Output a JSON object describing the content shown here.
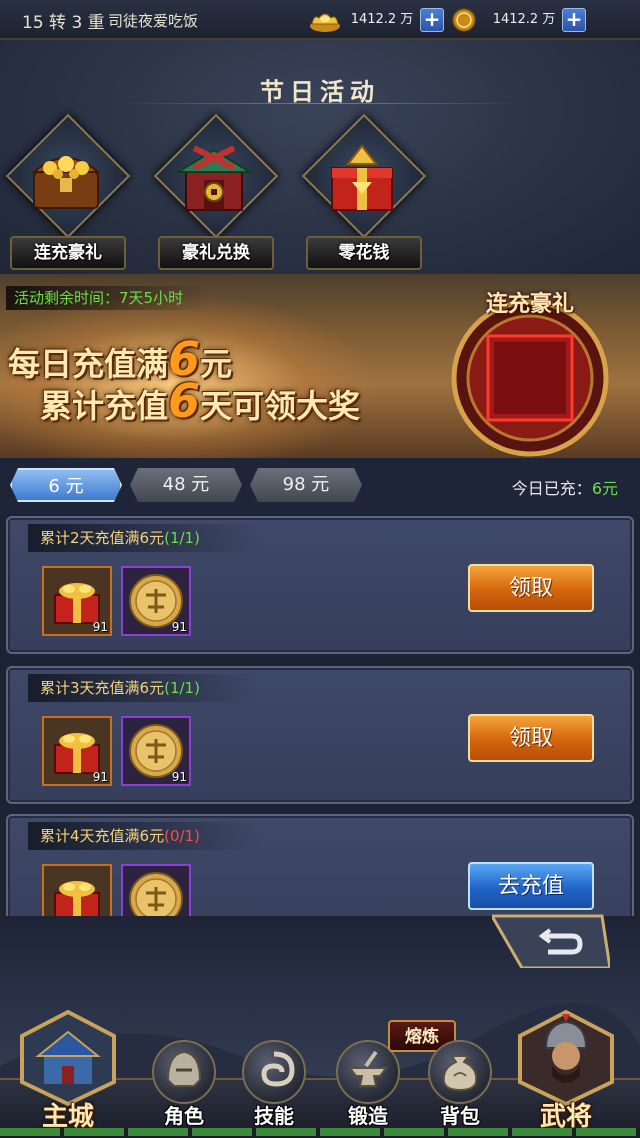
{
  "topbar": {
    "rebirth": "15 转 3 重",
    "player_name": "司徒夜爱吃饭",
    "gold_ingot": "1412.2 万",
    "coin": "1412.2 万"
  },
  "festival": {
    "title": "节日活动",
    "activities": [
      {
        "label": "连充豪礼"
      },
      {
        "label": "豪礼兑换"
      },
      {
        "label": "零花钱"
      }
    ]
  },
  "banner": {
    "timer_label": "活动剩余时间：",
    "timer_value": "7天5小时",
    "line1_pre": "每日充值满",
    "line1_num": "6",
    "line1_post": "元",
    "line2_pre": "累计充值",
    "line2_num": "6",
    "line2_post": "天可领大奖",
    "medal_title": "连充豪礼"
  },
  "tabs": [
    {
      "label": "6 元",
      "active": true
    },
    {
      "label": "48 元",
      "active": false
    },
    {
      "label": "98 元",
      "active": false
    }
  ],
  "charged": {
    "label": "今日已充：",
    "amount": "6元"
  },
  "tasks": [
    {
      "title": "累计2天充值满6元",
      "progress": "(1/1)",
      "complete": true,
      "rewards": [
        {
          "icon": "gift-box-icon",
          "qty": "91"
        },
        {
          "icon": "gold-coin-icon",
          "qty": "91"
        }
      ],
      "button": "领取"
    },
    {
      "title": "累计3天充值满6元",
      "progress": "(1/1)",
      "complete": true,
      "rewards": [
        {
          "icon": "gift-box-icon",
          "qty": "91"
        },
        {
          "icon": "gold-coin-icon",
          "qty": "91"
        }
      ],
      "button": "领取"
    },
    {
      "title": "累计4天充值满6元",
      "progress": "(0/1)",
      "complete": false,
      "rewards": [
        {
          "icon": "gift-box-icon",
          "qty": ""
        },
        {
          "icon": "gold-coin-icon",
          "qty": ""
        }
      ],
      "button": "去充值"
    }
  ],
  "nav": {
    "city": "主城",
    "role": "角色",
    "skill": "技能",
    "forge": "锻造",
    "smelt_badge": "熔炼",
    "bag": "背包",
    "general": "武将"
  },
  "colors": {
    "progress_done": "#6ddd4a",
    "progress_todo": "#ff4a4a",
    "claim_button": "#d4650c",
    "recharge_button": "#2164c8"
  }
}
